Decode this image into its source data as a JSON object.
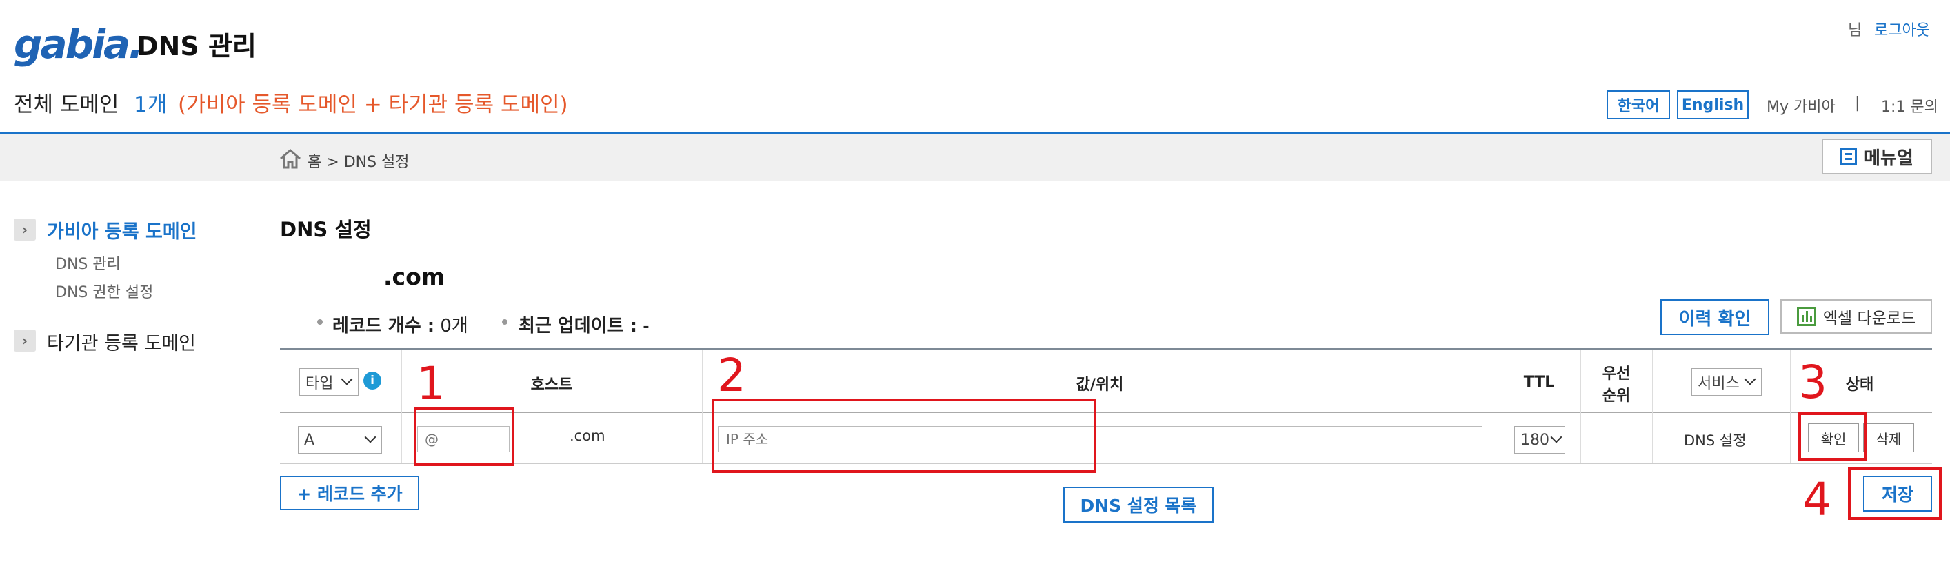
{
  "header": {
    "logo": "gabia.",
    "app_title": "DNS 관리",
    "user_suffix": "님",
    "logout": "로그아웃",
    "summary_label": "전체 도메인",
    "summary_count": "1개",
    "summary_note": "(가비아 등록 도메인 + 타기관 등록 도메인)",
    "lang_ko": "한국어",
    "lang_en": "English",
    "my_gabia": "My 가비아",
    "separator": "|",
    "inquiry": "1:1 문의",
    "accent_color": "#1a73c9",
    "note_color": "#e5582b"
  },
  "breadcrumb": {
    "home": "홈",
    "sep": ">",
    "current": "DNS 설정",
    "home_icon": "home-icon"
  },
  "manual_label": "메뉴얼",
  "sidebar": {
    "sections": [
      {
        "label": "가비아 등록 도메인",
        "items": [
          "DNS 관리",
          "DNS 권한 설정"
        ]
      },
      {
        "label": "타기관 등록 도메인",
        "items": []
      }
    ]
  },
  "main": {
    "title": "DNS 설정",
    "domain": ".com",
    "record_count_label": "레코드 개수 :",
    "record_count_value": "0개",
    "last_update_label": "최근 업데이트 :",
    "last_update_value": "-",
    "history_button": "이력 확인",
    "excel_button": "엑셀 다운로드"
  },
  "table": {
    "type_select": "타입",
    "host_header": "호스트",
    "value_header": "값/위치",
    "ttl_header": "TTL",
    "priority_header_1": "우선",
    "priority_header_2": "순위",
    "service_select": "서비스",
    "status_header": "상태",
    "row": {
      "type": "A",
      "host_placeholder": "@",
      "host_suffix": ".com",
      "value_placeholder": "IP 주소",
      "ttl": "180",
      "service": "DNS 설정",
      "confirm": "확인",
      "delete": "삭제"
    }
  },
  "footer": {
    "add_record": "+ 레코드 추가",
    "dns_list": "DNS 설정 목록",
    "save": "저장"
  },
  "annotations": {
    "n1": "1",
    "n2": "2",
    "n3": "3",
    "n4": "4",
    "color": "#e0161d"
  }
}
